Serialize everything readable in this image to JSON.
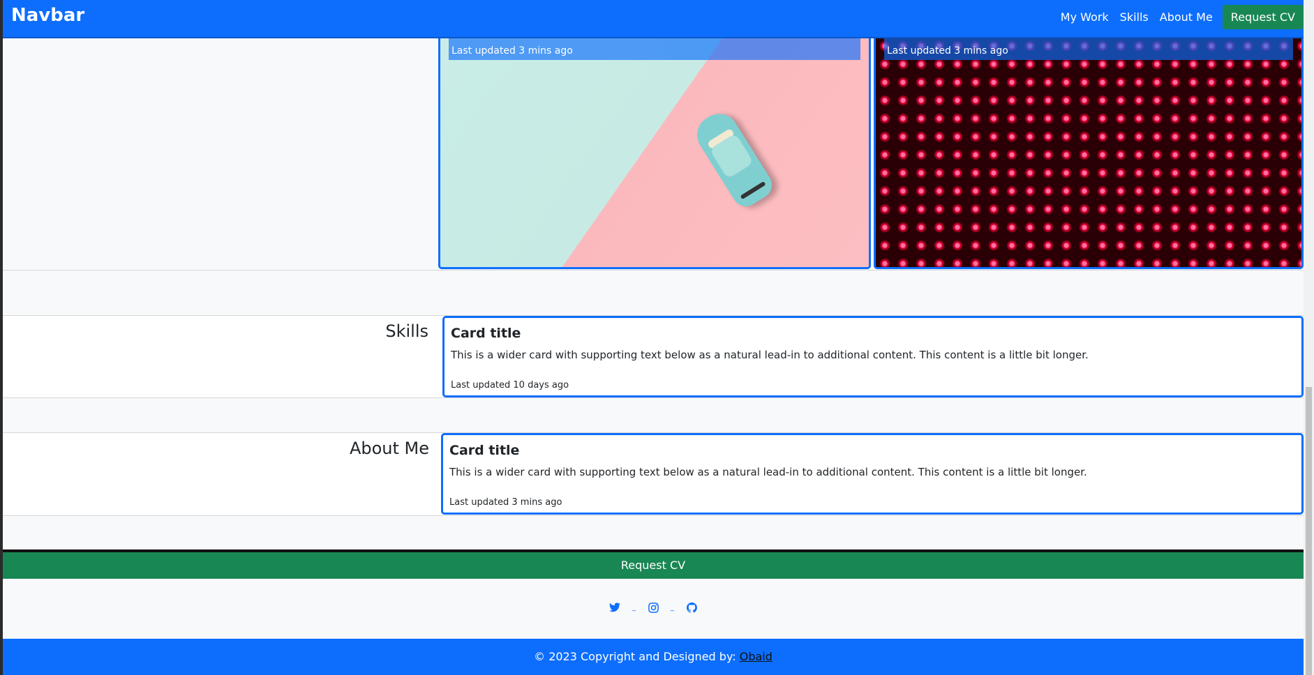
{
  "navbar": {
    "brand": "Navbar",
    "links": [
      "My Work",
      "Skills",
      "About Me"
    ],
    "cta": "Request CV"
  },
  "work": {
    "cards": [
      {
        "updated": "Last updated 3 mins ago",
        "image": "toy-car-on-mint-and-pink-background"
      },
      {
        "updated": "Last updated 3 mins ago",
        "image": "red-led-wall"
      }
    ]
  },
  "skills": {
    "heading": "Skills",
    "card": {
      "title": "Card title",
      "text": "This is a wider card with supporting text below as a natural lead-in to additional content. This content is a little bit longer.",
      "updated": "Last updated 10 days ago"
    }
  },
  "about": {
    "heading": "About Me",
    "card": {
      "title": "Card title",
      "text": "This is a wider card with supporting text below as a natural lead-in to additional content. This content is a little bit longer.",
      "updated": "Last updated 3 mins ago"
    }
  },
  "footer": {
    "cta": "Request CV",
    "social_icons": [
      "twitter-icon",
      "instagram-icon",
      "github-icon"
    ],
    "copyright_prefix": "© 2023 Copyright and Designed by: ",
    "author": "Obaid"
  },
  "colors": {
    "primary": "#0d6efd",
    "success": "#198754",
    "light": "#f8f9fa"
  }
}
